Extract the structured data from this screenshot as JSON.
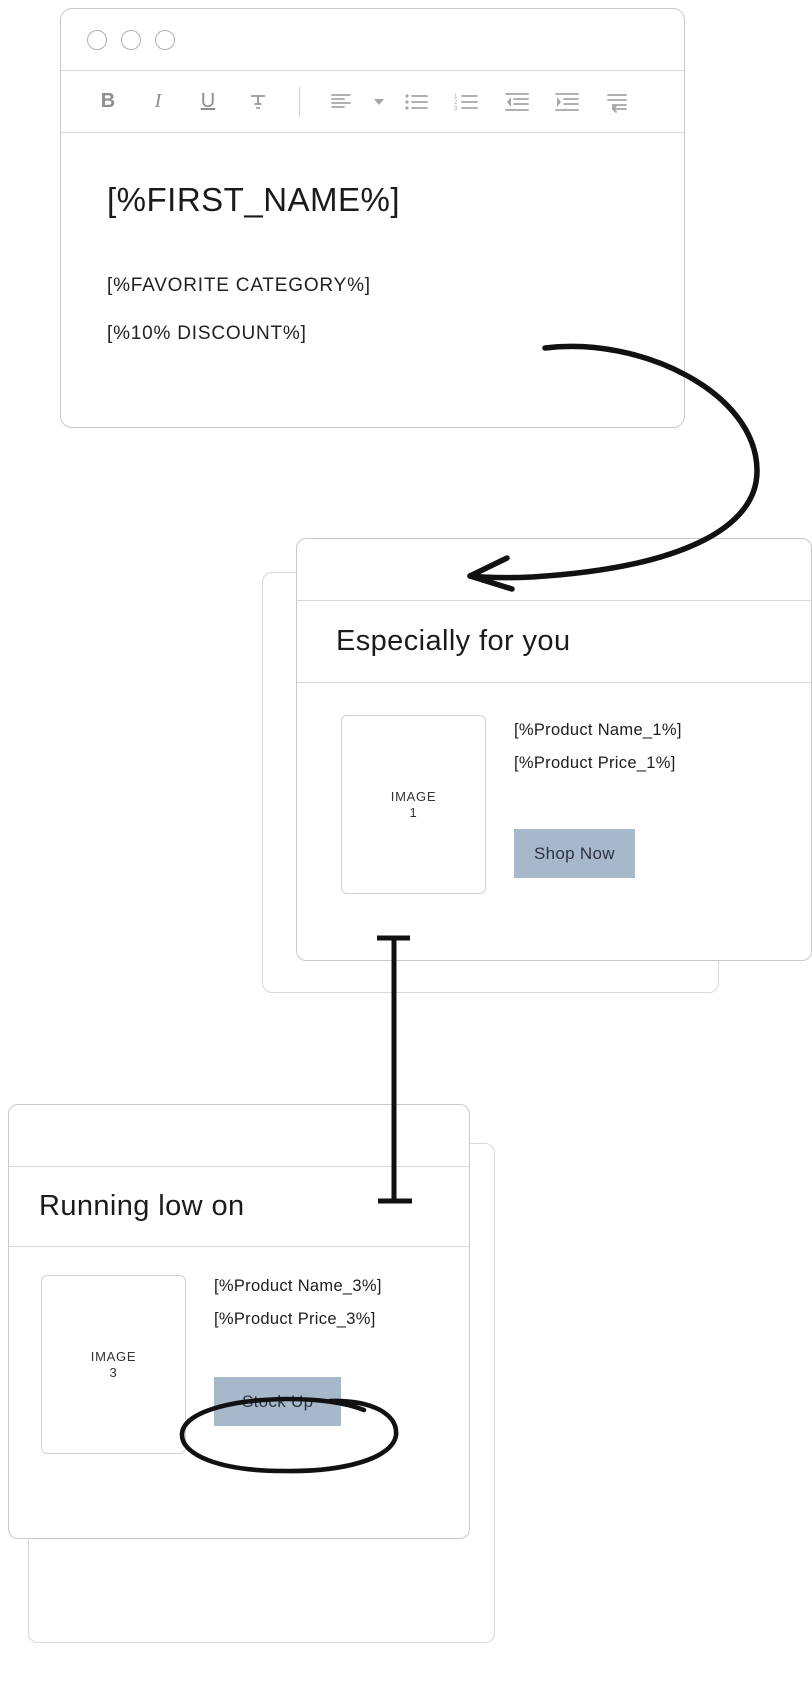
{
  "editor": {
    "window_controls": [
      "close-dot",
      "minimize-dot",
      "maximize-dot"
    ],
    "toolbar": [
      {
        "name": "bold-icon",
        "label": "B"
      },
      {
        "name": "italic-icon",
        "label": "I"
      },
      {
        "name": "underline-icon",
        "label": "U"
      },
      {
        "name": "strikethrough-icon",
        "label": "S"
      },
      {
        "name": "align-left-icon",
        "label": ""
      },
      {
        "name": "chevron-down-icon",
        "label": ""
      },
      {
        "name": "bulleted-list-icon",
        "label": ""
      },
      {
        "name": "numbered-list-icon",
        "label": ""
      },
      {
        "name": "decrease-indent-icon",
        "label": ""
      },
      {
        "name": "increase-indent-icon",
        "label": ""
      },
      {
        "name": "clear-formatting-icon",
        "label": ""
      }
    ],
    "heading": "[%FIRST_NAME%]",
    "lines": [
      "[%FAVORITE CATEGORY%]",
      "[%10% DISCOUNT%]"
    ]
  },
  "cards": [
    {
      "title": "Especially for you",
      "image_label_line1": "IMAGE",
      "image_label_line2": "1",
      "product_name": "[%Product Name_1%]",
      "product_price": "[%Product Price_1%]",
      "cta_label": "Shop Now"
    },
    {
      "title": "Running low on",
      "image_label_line1": "IMAGE",
      "image_label_line2": "3",
      "product_name": "[%Product Name_3%]",
      "product_price": "[%Product Price_3%]",
      "cta_label": "Stock Up"
    }
  ],
  "annotations": {
    "curved_arrow": "curved-arrow-from-editor-to-card",
    "connector": "vertical-connector-line",
    "highlight_ellipse": "hand-drawn-ellipse-around-stock-up"
  },
  "colors": {
    "cta_background": "#a8b8cb",
    "cta_text": "#2b3340",
    "card_border": "#c9c9c9",
    "ink": "#1b1b1b",
    "toolbar_icon": "#9a9a9a"
  }
}
